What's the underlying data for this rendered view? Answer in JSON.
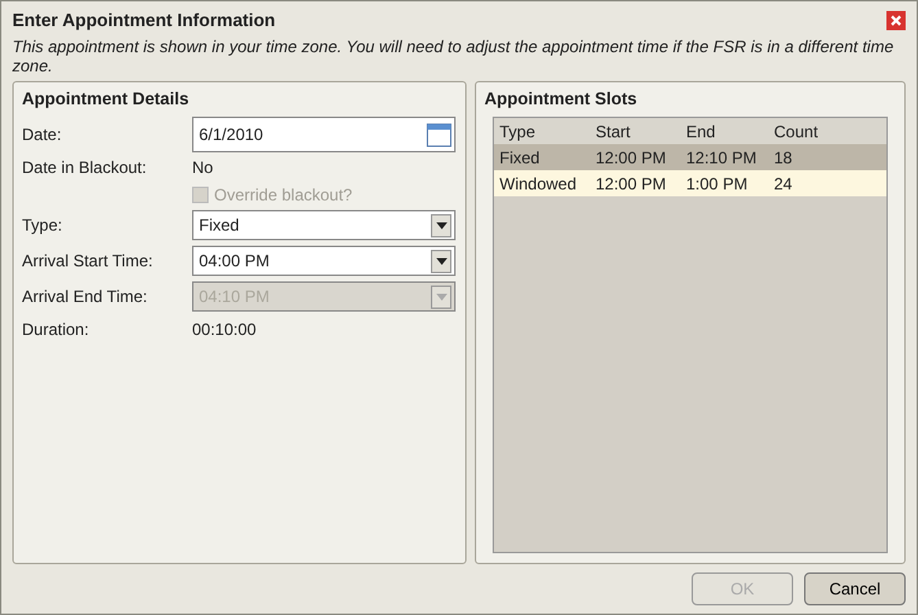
{
  "dialog": {
    "title": "Enter Appointment Information",
    "notice": "This appointment is shown in your time zone.  You will need to adjust the appointment time if the FSR is in a different time zone."
  },
  "details": {
    "title": "Appointment Details",
    "rows": [
      {
        "kind": "date",
        "label": "Date:",
        "value": "6/1/2010"
      },
      {
        "kind": "text",
        "label": "Date in Blackout:",
        "value": "No"
      },
      {
        "kind": "checkbox",
        "label": "Override blackout?",
        "checked": false,
        "disabled": true
      },
      {
        "kind": "select",
        "label": "Type:",
        "value": "Fixed",
        "disabled": false
      },
      {
        "kind": "select",
        "label": "Arrival Start Time:",
        "value": "04:00 PM",
        "disabled": false
      },
      {
        "kind": "select",
        "label": "Arrival End Time:",
        "value": "04:10 PM",
        "disabled": true
      },
      {
        "kind": "text",
        "label": "Duration:",
        "value": "00:10:00"
      }
    ]
  },
  "slots": {
    "title": "Appointment Slots",
    "columns": [
      "Type",
      "Start",
      "End",
      "Count"
    ],
    "rows": [
      {
        "cells": [
          "Fixed",
          "12:00 PM",
          "12:10 PM",
          "18"
        ],
        "selected": true
      },
      {
        "cells": [
          "Windowed",
          "12:00 PM",
          "1:00 PM",
          "24"
        ],
        "selected": false
      }
    ]
  },
  "buttons": [
    {
      "label": "OK",
      "disabled": true
    },
    {
      "label": "Cancel",
      "disabled": false
    }
  ]
}
